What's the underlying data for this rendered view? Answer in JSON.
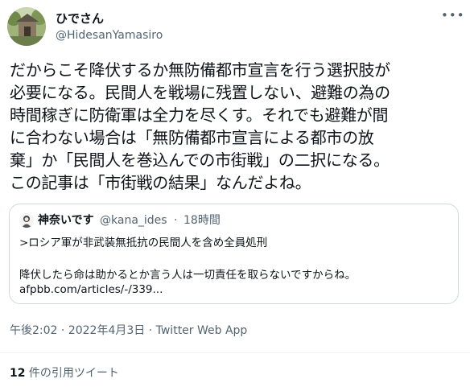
{
  "author": {
    "display_name": "ひでさん",
    "handle": "@HidesanYamasiro"
  },
  "tweet": {
    "text": "だからこそ降伏するか無防備都市宣言を行う選択肢が\n必要になる。民間人を戦場に残置しない、避難の為の\n時間稼ぎに防衛軍は全力を尽くす。それでも避難が間\nに合わない場合は「無防備都市宣言による都市の放\n棄」か「民間人を巻込んでの市街戦」の二択になる。\nこの記事は「市街戦の結果」なんだよね。"
  },
  "quoted": {
    "display_name": "神奈いです",
    "handle": "@kana_ides",
    "separator": "·",
    "time": "18時間",
    "line1": ">ロシア軍が非武装無抵抗の民間人を含め全員処刑",
    "line2": "降伏したら命は助かるとか言う人は一切責任を取らないですからね。",
    "link": "afpbb.com/articles/-/339..."
  },
  "meta": {
    "time": "午後2:02",
    "separator1": "·",
    "date": "2022年4月3日",
    "separator2": "·",
    "source": "Twitter Web App"
  },
  "stats": {
    "quote_count": "12",
    "quote_label": " 件の引用ツイート"
  },
  "icons": {
    "more": "more-icon"
  },
  "colors": {
    "text": "#0f1419",
    "secondary": "#536471",
    "border": "#cfd9de"
  }
}
